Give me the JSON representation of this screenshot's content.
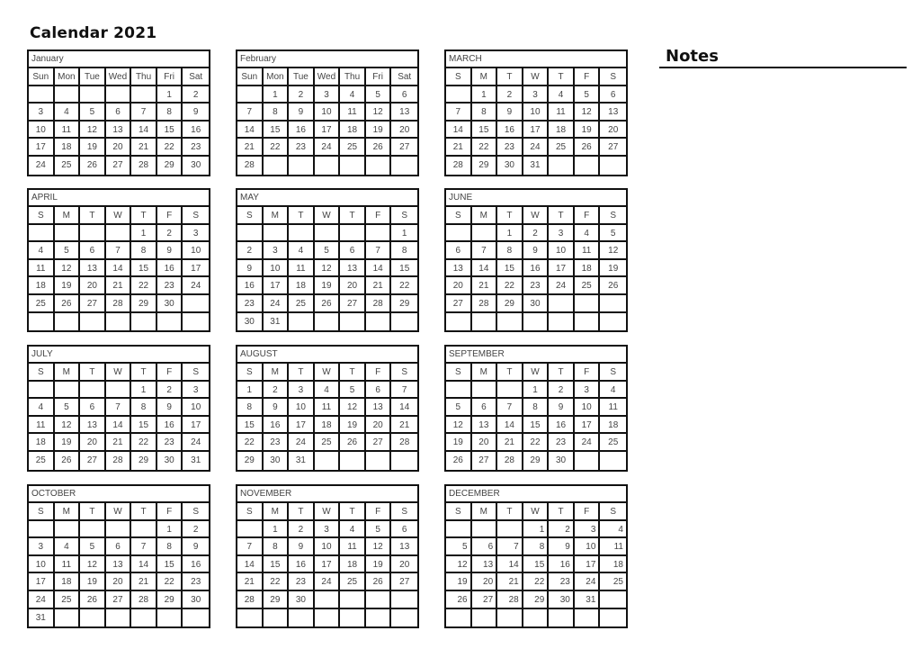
{
  "title": "Calendar 2021",
  "notes_label": "Notes",
  "months": [
    {
      "name": "January",
      "weekdays": [
        "Sun",
        "Mon",
        "Tue",
        "Wed",
        "Thu",
        "Fri",
        "Sat"
      ],
      "start": 5,
      "days": 30,
      "rows": 5,
      "align": "center"
    },
    {
      "name": "February",
      "weekdays": [
        "Sun",
        "Mon",
        "Tue",
        "Wed",
        "Thu",
        "Fri",
        "Sat"
      ],
      "start": 1,
      "days": 28,
      "rows": 5,
      "align": "center"
    },
    {
      "name": "MARCH",
      "weekdays": [
        "S",
        "M",
        "T",
        "W",
        "T",
        "F",
        "S"
      ],
      "start": 1,
      "days": 31,
      "rows": 5,
      "align": "center"
    },
    {
      "name": "APRIL",
      "weekdays": [
        "S",
        "M",
        "T",
        "W",
        "T",
        "F",
        "S"
      ],
      "start": 4,
      "days": 30,
      "rows": 6,
      "align": "center"
    },
    {
      "name": "MAY",
      "weekdays": [
        "S",
        "M",
        "T",
        "W",
        "T",
        "F",
        "S"
      ],
      "start": 6,
      "days": 31,
      "rows": 6,
      "align": "center"
    },
    {
      "name": "JUNE",
      "weekdays": [
        "S",
        "M",
        "T",
        "W",
        "T",
        "F",
        "S"
      ],
      "start": 2,
      "days": 30,
      "rows": 6,
      "align": "center"
    },
    {
      "name": "JULY",
      "weekdays": [
        "S",
        "M",
        "T",
        "W",
        "T",
        "F",
        "S"
      ],
      "start": 4,
      "days": 31,
      "rows": 5,
      "align": "center"
    },
    {
      "name": "AUGUST",
      "weekdays": [
        "S",
        "M",
        "T",
        "W",
        "T",
        "F",
        "S"
      ],
      "start": 0,
      "days": 31,
      "rows": 5,
      "align": "center"
    },
    {
      "name": "SEPTEMBER",
      "weekdays": [
        "S",
        "M",
        "T",
        "W",
        "T",
        "F",
        "S"
      ],
      "start": 3,
      "days": 30,
      "rows": 5,
      "align": "center"
    },
    {
      "name": "OCTOBER",
      "weekdays": [
        "S",
        "M",
        "T",
        "W",
        "T",
        "F",
        "S"
      ],
      "start": 5,
      "days": 31,
      "rows": 6,
      "align": "center"
    },
    {
      "name": "NOVEMBER",
      "weekdays": [
        "S",
        "M",
        "T",
        "W",
        "T",
        "F",
        "S"
      ],
      "start": 1,
      "days": 30,
      "rows": 6,
      "align": "center"
    },
    {
      "name": "DECEMBER",
      "weekdays": [
        "S",
        "M",
        "T",
        "W",
        "T",
        "F",
        "S"
      ],
      "start": 3,
      "days": 31,
      "rows": 6,
      "align": "right"
    }
  ]
}
